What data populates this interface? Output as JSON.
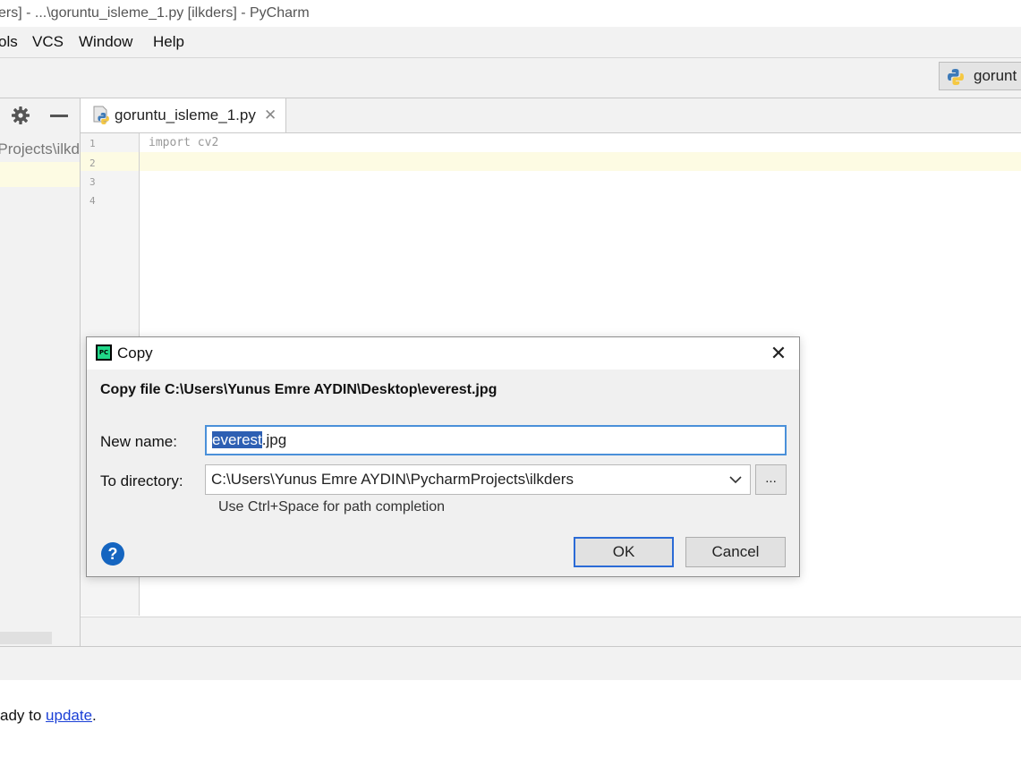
{
  "window": {
    "title": "ers] - ...\\goruntu_isleme_1.py [ilkders] - PyCharm"
  },
  "menu": {
    "items": [
      "ols",
      "VCS",
      "Window",
      "Help"
    ]
  },
  "toolbar": {
    "run_config_label": "gorunt"
  },
  "project_panel": {
    "path_fragment": "Projects\\ilkd"
  },
  "editor": {
    "tab_label": "goruntu_isleme_1.py",
    "tab_close": "✕",
    "line_numbers": [
      "1",
      "2",
      "3",
      "4"
    ],
    "lines": [
      "import cv2",
      "",
      "",
      ""
    ]
  },
  "status": {
    "prefix": "ady to ",
    "link": "update",
    "suffix": "."
  },
  "dialog": {
    "title": "Copy",
    "close": "✕",
    "heading": "Copy file C:\\Users\\Yunus Emre AYDIN\\Desktop\\everest.jpg",
    "name_label": "New name:",
    "name_value_selected": "everest",
    "name_value_rest": ".jpg",
    "dir_label": "To directory:",
    "dir_value": "C:\\Users\\Yunus Emre AYDIN\\PycharmProjects\\ilkders",
    "browse_label": "...",
    "hint": "Use Ctrl+Space for path completion",
    "help": "?",
    "ok_label": "OK",
    "cancel_label": "Cancel"
  },
  "colors": {
    "accent": "#2b6bd6",
    "selection": "#2d5fb3",
    "current_line": "#fdfbe3",
    "link": "#1a3fd6"
  }
}
